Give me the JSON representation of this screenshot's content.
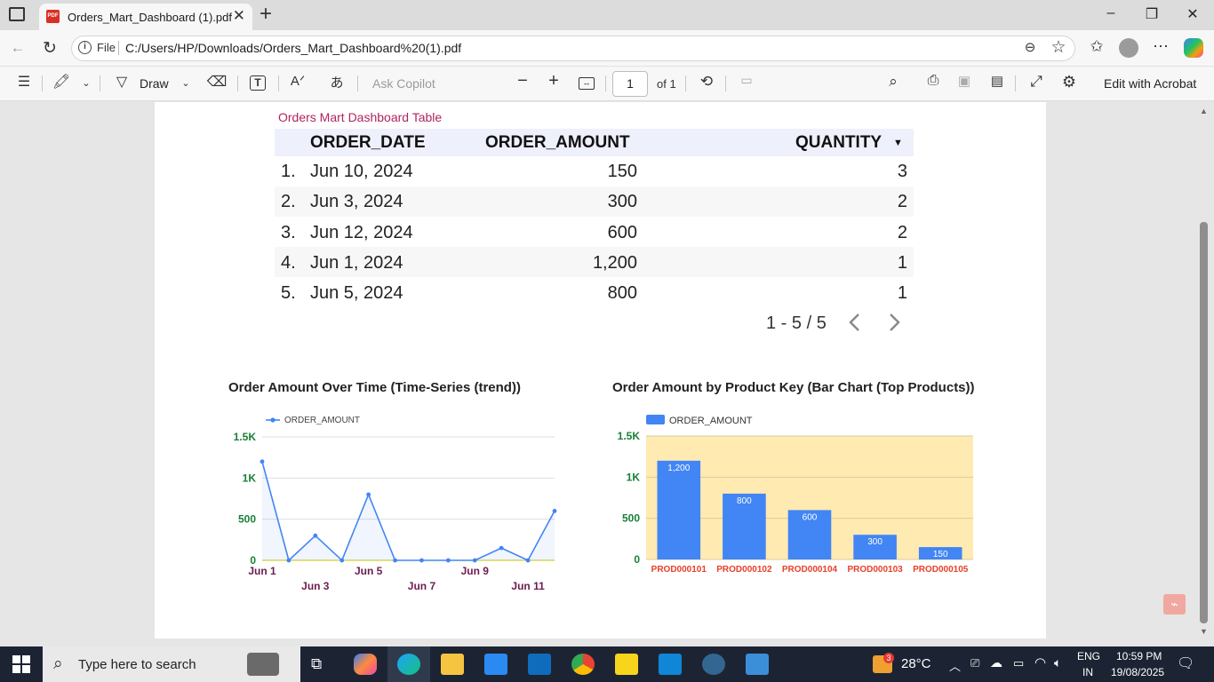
{
  "browser": {
    "tab_title": "Orders_Mart_Dashboard (1).pdf",
    "tab_close": "✕",
    "new_tab": "+",
    "file_label": "File",
    "url": "C:/Users/HP/Downloads/Orders_Mart_Dashboard%20(1).pdf"
  },
  "pdf_toolbar": {
    "draw_label": "Draw",
    "copilot_placeholder": "Ask Copilot",
    "page_current": "1",
    "page_total": "of 1",
    "acrobat_label": "Edit with Acrobat"
  },
  "table": {
    "title": "Orders Mart Dashboard Table",
    "headers": {
      "date": "ORDER_DATE",
      "amount": "ORDER_AMOUNT",
      "quantity": "QUANTITY"
    },
    "rows": [
      {
        "n": "1.",
        "date": "Jun 10, 2024",
        "amount": "150",
        "qty": "3"
      },
      {
        "n": "2.",
        "date": "Jun 3, 2024",
        "amount": "300",
        "qty": "2"
      },
      {
        "n": "3.",
        "date": "Jun 12, 2024",
        "amount": "600",
        "qty": "2"
      },
      {
        "n": "4.",
        "date": "Jun 1, 2024",
        "amount": "1,200",
        "qty": "1"
      },
      {
        "n": "5.",
        "date": "Jun 5, 2024",
        "amount": "800",
        "qty": "1"
      }
    ],
    "pagination": "1 - 5 / 5"
  },
  "chart_data": [
    {
      "type": "line",
      "title": "Order Amount Over Time (Time-Series (trend))",
      "legend": "top-left",
      "grid": true,
      "ylim": [
        0,
        1500
      ],
      "y_ticks": [
        "0",
        "500",
        "1K",
        "1.5K"
      ],
      "x_tick_labels": [
        "Jun 1",
        "Jun 3",
        "Jun 5",
        "Jun 7",
        "Jun 9",
        "Jun 11"
      ],
      "x": [
        "Jun 1",
        "Jun 2",
        "Jun 3",
        "Jun 4",
        "Jun 5",
        "Jun 6",
        "Jun 7",
        "Jun 8",
        "Jun 9",
        "Jun 10",
        "Jun 11",
        "Jun 12"
      ],
      "series": [
        {
          "name": "ORDER_AMOUNT",
          "values": [
            1200,
            0,
            300,
            0,
            800,
            0,
            0,
            0,
            0,
            150,
            0,
            600
          ]
        }
      ],
      "colors": {
        "line": "#4285f4",
        "ytick": "#188038",
        "xtick": "#6d1b4f"
      }
    },
    {
      "type": "bar",
      "title": "Order Amount by Product Key (Bar Chart (Top Products))",
      "legend": "top-left",
      "grid": true,
      "ylim": [
        0,
        1500
      ],
      "y_ticks": [
        "0",
        "500",
        "1K",
        "1.5K"
      ],
      "categories": [
        "PROD000101",
        "PROD000102",
        "PROD000104",
        "PROD000103",
        "PROD000105"
      ],
      "series": [
        {
          "name": "ORDER_AMOUNT",
          "values": [
            1200,
            800,
            600,
            300,
            150
          ]
        }
      ],
      "data_labels": [
        "1,200",
        "800",
        "600",
        "300",
        "150"
      ],
      "colors": {
        "bar": "#4285f4",
        "plot_bg": "#ffeab2",
        "ytick": "#188038",
        "xtick": "#e8402a"
      }
    }
  ],
  "taskbar": {
    "search_placeholder": "Type here to search",
    "weather": "28°C",
    "lang1": "ENG",
    "lang2": "IN",
    "time": "10:59 PM",
    "date": "19/08/2025",
    "badge": "3"
  }
}
